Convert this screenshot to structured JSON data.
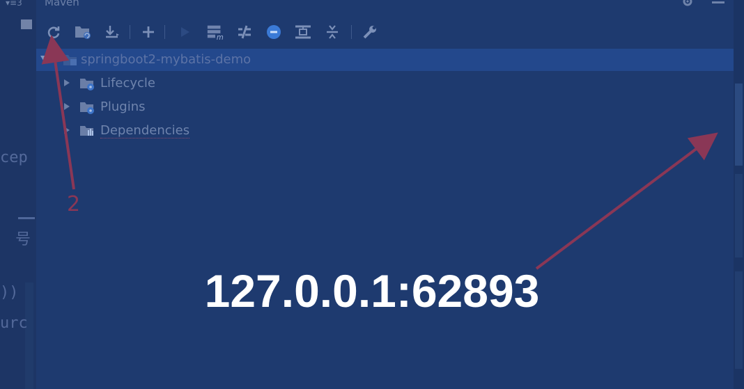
{
  "editor": {
    "top_label": "▾≡3",
    "code_fragments": [
      "cep",
      "号",
      "))",
      "urc"
    ]
  },
  "maven_panel": {
    "title": "Maven",
    "toolbar": {
      "buttons": [
        {
          "name": "reimport-all-maven-projects",
          "icon": "refresh-icon"
        },
        {
          "name": "generate-sources",
          "icon": "folder-refresh-icon"
        },
        {
          "name": "download-sources",
          "icon": "download-icon"
        },
        {
          "name": "add-maven-project",
          "icon": "plus-icon"
        },
        {
          "name": "run-maven-build",
          "icon": "play-icon"
        },
        {
          "name": "execute-maven-goal",
          "icon": "maven-goal-icon"
        },
        {
          "name": "toggle-offline-mode",
          "icon": "offline-icon"
        },
        {
          "name": "skip-tests",
          "icon": "skip-tests-icon"
        },
        {
          "name": "show-dependencies",
          "icon": "dependencies-icon"
        },
        {
          "name": "collapse-all",
          "icon": "collapse-icon"
        },
        {
          "name": "maven-settings",
          "icon": "wrench-icon"
        }
      ]
    },
    "tree": {
      "root": {
        "label": "springboot2-mybatis-demo",
        "icon": "maven-project-icon"
      },
      "children": [
        {
          "label": "Lifecycle",
          "icon": "lifecycle-folder-icon"
        },
        {
          "label": "Plugins",
          "icon": "plugins-folder-icon"
        },
        {
          "label": "Dependencies",
          "icon": "dependencies-folder-icon"
        }
      ]
    }
  },
  "annotation": {
    "step_number": "2",
    "color": "#8a3756"
  },
  "overlay": {
    "address": "127.0.0.1:62893"
  },
  "colors": {
    "overlay_tint": "#1f3a6e",
    "selection": "#23488c",
    "accent_blue": "#3b7ad6"
  }
}
